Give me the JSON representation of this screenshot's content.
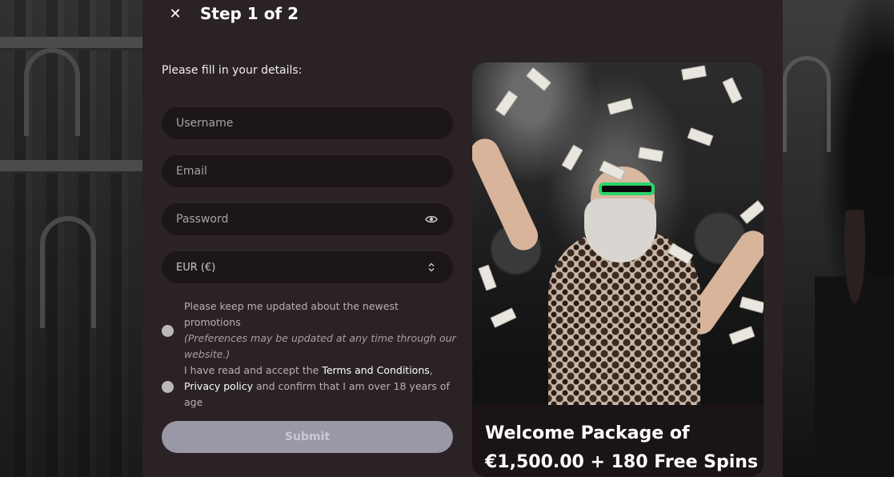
{
  "header": {
    "step_title": "Step 1 of 2"
  },
  "form": {
    "intro": "Please fill in your details:",
    "username_placeholder": "Username",
    "email_placeholder": "Email",
    "password_placeholder": "Password",
    "currency_value": "EUR (€)",
    "promo_checkbox": {
      "line1": "Please keep me updated about the newest promotions",
      "note": "(Preferences may be updated at any time through our website.)"
    },
    "terms_checkbox": {
      "prefix": "I have read and accept the ",
      "terms_link": "Terms and Conditions",
      "comma": ",",
      "privacy_link": "Privacy policy",
      "suffix": " and confirm that I am over 18 years of age"
    },
    "submit_label": "Submit"
  },
  "promo": {
    "line1": "Welcome Package of",
    "line2": "€1,500.00 + 180 Free Spins"
  },
  "icons": {
    "close": "close-icon",
    "eye": "eye-icon",
    "select": "chevron-updown-icon"
  },
  "colors": {
    "modal_bg": "#2a2225",
    "field_bg": "#1c1618",
    "submit_bg": "#9a98a6",
    "accent_glasses": "#2bd46c"
  }
}
